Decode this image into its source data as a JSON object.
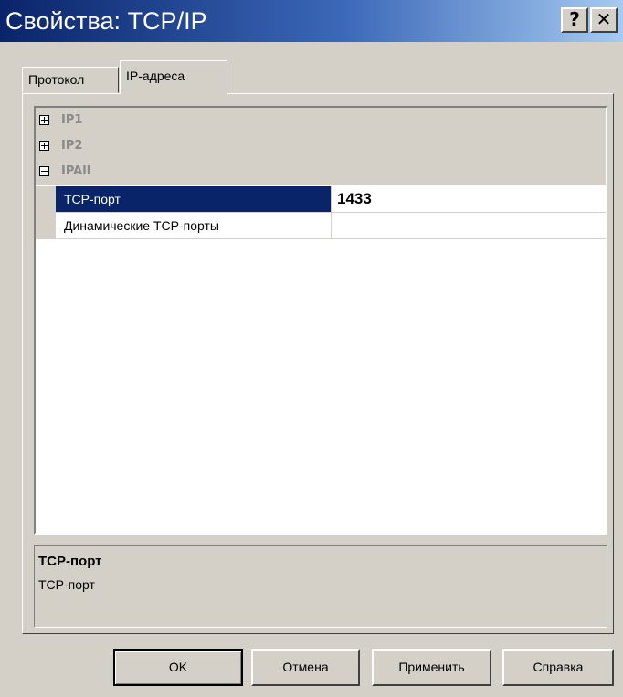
{
  "window": {
    "title": "Свойства: TCP/IP",
    "help_glyph": "?",
    "close_glyph": "✕"
  },
  "tabs": [
    {
      "label": "Протокол",
      "selected": false
    },
    {
      "label": "IP-адреса",
      "selected": true
    }
  ],
  "grid": {
    "groups": [
      {
        "label": "IP1",
        "expanded": false
      },
      {
        "label": "IP2",
        "expanded": false
      },
      {
        "label": "IPAll",
        "expanded": true
      }
    ],
    "properties": [
      {
        "name": "TCP-порт",
        "value": "1433",
        "selected": true
      },
      {
        "name": "Динамические TCP-порты",
        "value": "",
        "selected": false
      }
    ]
  },
  "description": {
    "title": "TCP-порт",
    "text": "TCP-порт"
  },
  "buttons": {
    "ok": "OK",
    "cancel": "Отмена",
    "apply": "Применить",
    "help": "Справка"
  },
  "colors": {
    "face": "#d4d0c8",
    "title_gradient_start": "#0a246a",
    "title_gradient_end": "#a6caf0",
    "selection": "#0a246a"
  },
  "icons": {
    "collapsed": "plus-box-icon",
    "expanded": "minus-box-icon"
  }
}
